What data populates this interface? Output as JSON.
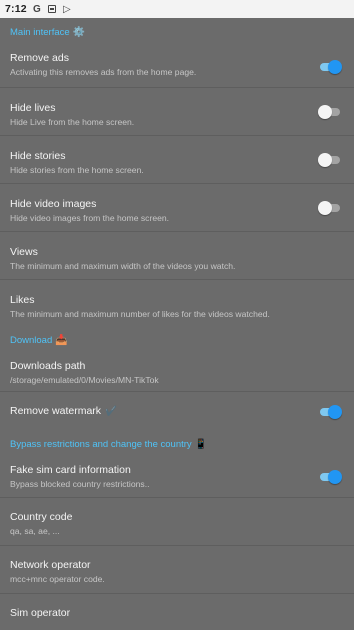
{
  "status_bar": {
    "time": "7:12",
    "icons": [
      "google-g-icon",
      "notification-square-icon",
      "play-store-icon"
    ],
    "g_glyph": "G",
    "play_glyph": "▷"
  },
  "accent_color": "#4fc3f7",
  "switch_on_color": "#2196f3",
  "sections": {
    "main": {
      "title": "Main interface",
      "emoji": "⚙️",
      "items": {
        "remove_ads": {
          "title": "Remove ads",
          "summary": "Activating this removes ads from the home page.",
          "checked": true
        },
        "hide_lives": {
          "title": "Hide lives",
          "summary": "Hide Live from the home screen.",
          "checked": false
        },
        "hide_stories": {
          "title": "Hide stories",
          "summary": "Hide stories from the home screen.",
          "checked": false
        },
        "hide_video_images": {
          "title": "Hide video images",
          "summary": "Hide video images from the home screen.",
          "checked": false
        },
        "views": {
          "title": "Views",
          "summary": "The minimum and maximum width of the videos you watch."
        },
        "likes": {
          "title": "Likes",
          "summary": "The minimum and maximum number of likes for the videos watched."
        }
      }
    },
    "download": {
      "title": "Download",
      "emoji": "📥",
      "items": {
        "downloads_path": {
          "title": "Downloads path",
          "summary": "/storage/emulated/0/Movies/MN-TikTok"
        },
        "remove_watermark": {
          "title": "Remove watermark",
          "emoji": "✔️",
          "checked": true
        }
      }
    },
    "bypass": {
      "title": "Bypass restrictions and change the country",
      "emoji": "📱",
      "items": {
        "fake_sim": {
          "title": "Fake sim card information",
          "summary": "Bypass blocked country restrictions..",
          "checked": true
        },
        "country_code": {
          "title": "Country code",
          "summary": "qa, sa, ae, ..."
        },
        "network_operator": {
          "title": "Network operator",
          "summary": "mcc+mnc operator code."
        },
        "sim_operator": {
          "title": "Sim operator"
        }
      }
    }
  }
}
